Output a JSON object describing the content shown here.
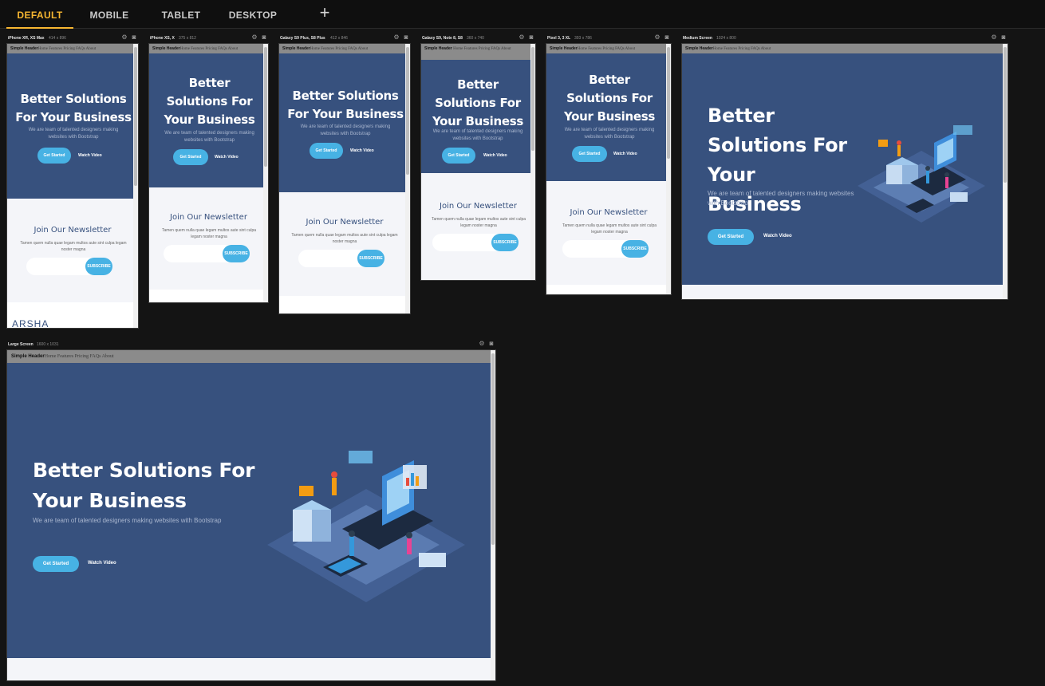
{
  "tabs": [
    {
      "label": "DEFAULT",
      "active": true
    },
    {
      "label": "MOBILE",
      "active": false
    },
    {
      "label": "TABLET",
      "active": false
    },
    {
      "label": "DESKTOP",
      "active": false
    }
  ],
  "add_tab_symbol": "+",
  "site": {
    "brand": "Simple Header",
    "nav": "Home Features Pricing FAQs About",
    "hero_title": "Better Solutions For Your Business",
    "hero_subtitle": "We are team of talented designers making websites with Bootstrap",
    "get_started": "Get Started",
    "watch_video": "Watch Video",
    "newsletter_title": "Join Our Newsletter",
    "newsletter_text": "Tamen quem nulla quae legam multos aute sint culpa legam noster magna",
    "subscribe": "SUBSCRIBE",
    "footer_logo": "ARSHA"
  },
  "devices": [
    {
      "name": "iPhone XR, XS Max",
      "size": "414 x 896"
    },
    {
      "name": "iPhone XS, X",
      "size": "375 x 812"
    },
    {
      "name": "Galaxy S9 Plus, S8 Plus",
      "size": "412 x 846"
    },
    {
      "name": "Galaxy S9, Note 8, S8",
      "size": "360 x 740"
    },
    {
      "name": "Pixel 3, 3 XL",
      "size": "393 x 786"
    },
    {
      "name": "Medium Screen",
      "size": "1024 x 800"
    },
    {
      "name": "Large Screen",
      "size": "1600 x 1031"
    }
  ],
  "colors": {
    "accent": "#f7b731",
    "hero_bg": "#37517e",
    "button": "#47b2e4",
    "page_bg": "#f4f5f9"
  },
  "icons": {
    "settings": "gear-icon",
    "screenshot": "camera-icon"
  }
}
